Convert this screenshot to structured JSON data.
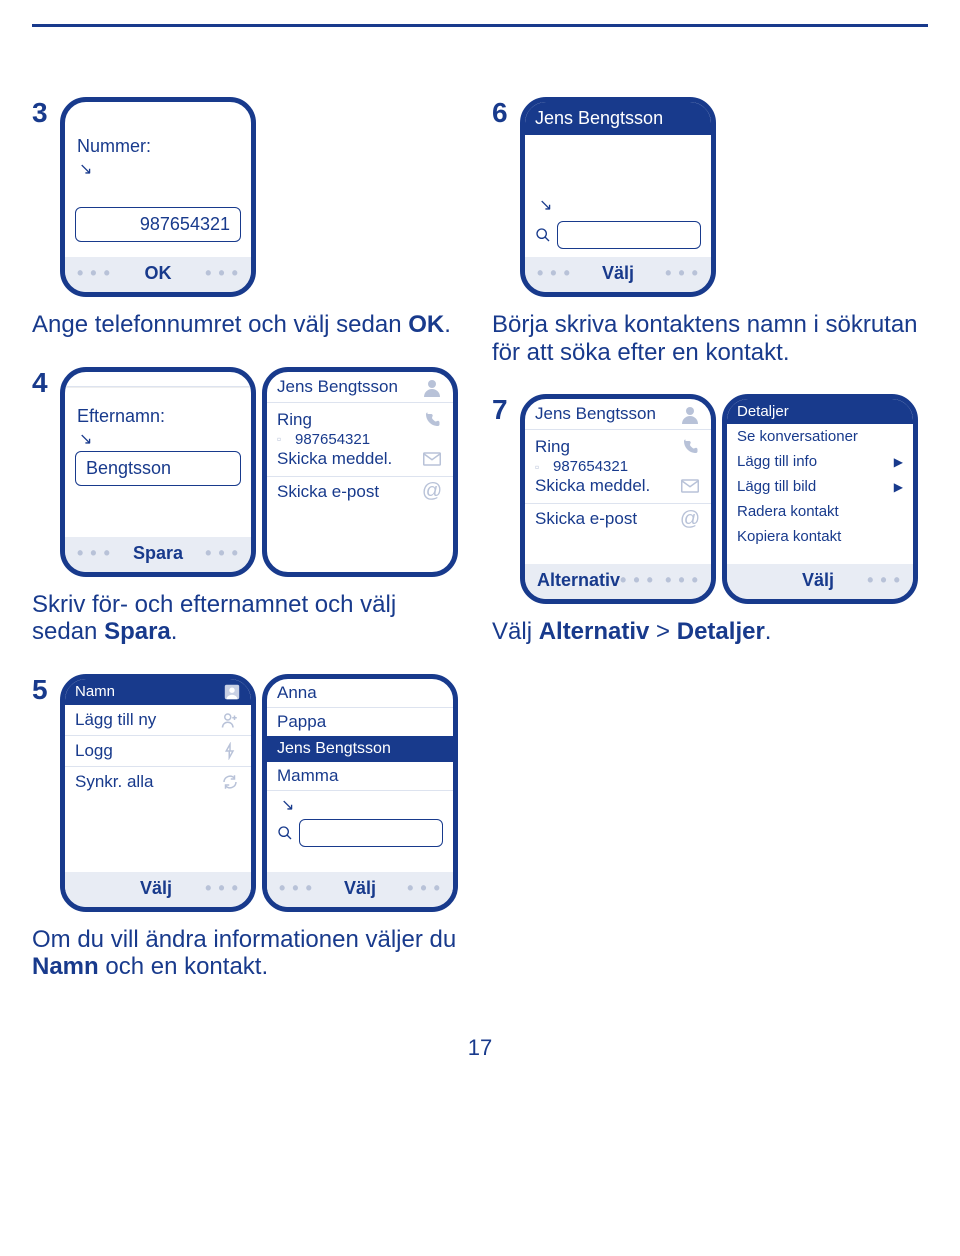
{
  "page_number": "17",
  "step3": {
    "num": "3",
    "label": "Nummer:",
    "value": "987654321",
    "soft_center": "OK",
    "instruction_pre": "Ange telefonnumret och välj sedan ",
    "instruction_bold": "OK",
    "instruction_post": "."
  },
  "step4": {
    "num": "4",
    "left": {
      "label": "Efternamn:",
      "value": "Bengtsson",
      "soft_center": "Spara"
    },
    "right": {
      "name": "Jens Bengtsson",
      "ring": "Ring",
      "number": "987654321",
      "send_msg": "Skicka meddel.",
      "send_mail": "Skicka e-post"
    },
    "instruction_pre": "Skriv för- och efternamnet och välj sedan ",
    "instruction_bold": "Spara",
    "instruction_post": "."
  },
  "step5": {
    "num": "5",
    "left": {
      "title": "Namn",
      "add": "Lägg till ny",
      "log": "Logg",
      "sync": "Synkr. alla",
      "soft_center": "Välj"
    },
    "right": {
      "c1": "Anna",
      "c2": "Pappa",
      "c3_sel": "Jens Bengtsson",
      "c4": "Mamma",
      "soft_center": "Välj"
    },
    "instruction_pre": "Om du vill ändra informationen väljer du ",
    "instruction_bold": "Namn",
    "instruction_post": " och en kontakt."
  },
  "step6": {
    "num": "6",
    "title": "Jens Bengtsson",
    "soft_center": "Välj",
    "instruction": "Börja skriva kontaktens namn i sökrutan för att söka efter en kontakt."
  },
  "step7": {
    "num": "7",
    "left": {
      "name": "Jens Bengtsson",
      "ring": "Ring",
      "number": "987654321",
      "send_msg": "Skicka meddel.",
      "send_mail": "Skicka e-post",
      "soft_left": "Alternativ"
    },
    "right": {
      "title": "Detaljer",
      "m1": "Se konversationer",
      "m2": "Lägg till info",
      "m3": "Lägg till bild",
      "m4": "Radera kontakt",
      "m5": "Kopiera kontakt",
      "soft_center": "Välj"
    },
    "instruction_pre": "Välj ",
    "instruction_b1": "Alternativ",
    "instruction_mid": " > ",
    "instruction_b2": "Detaljer",
    "instruction_post": "."
  },
  "dots": "•  •  •"
}
